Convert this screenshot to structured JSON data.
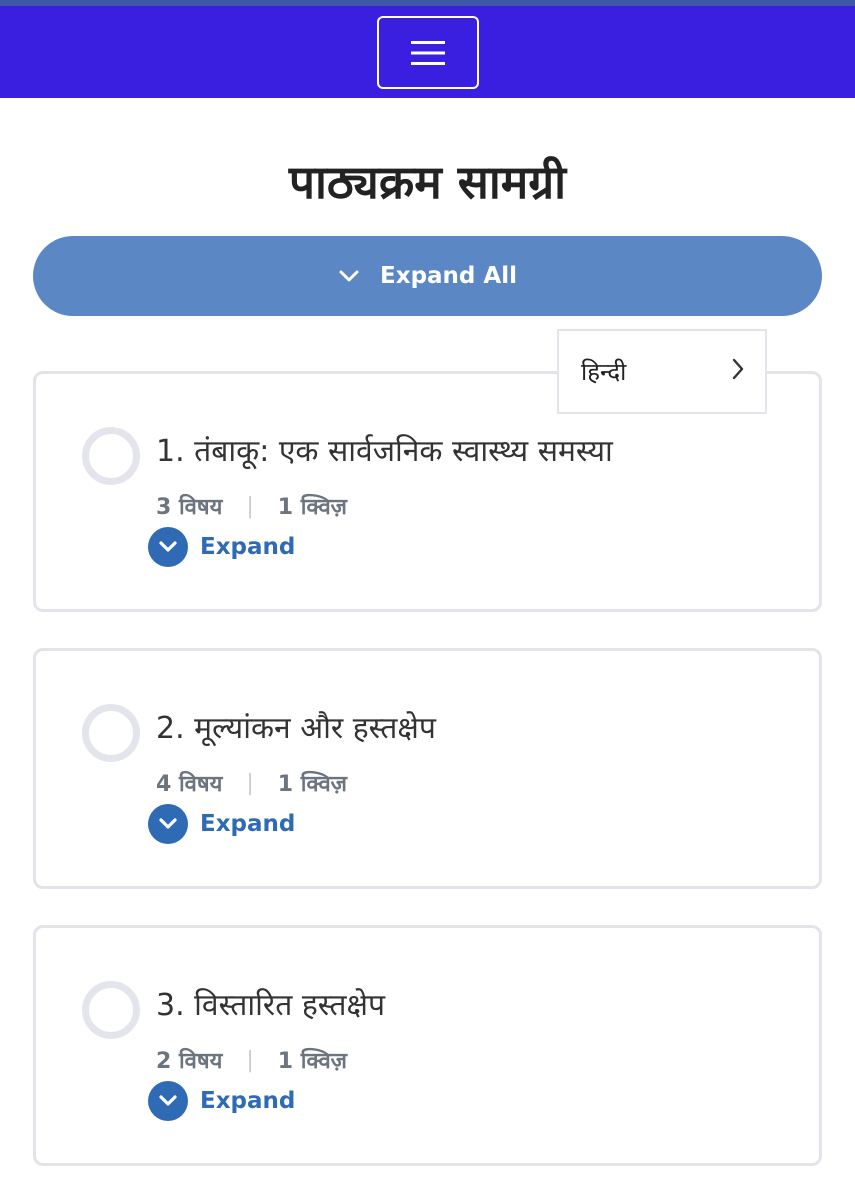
{
  "navbar": {
    "menu_icon": "hamburger-menu-icon"
  },
  "page": {
    "title": "पाठ्यक्रम सामग्री"
  },
  "expand_all": {
    "label": "Expand All",
    "icon": "chevron-down-icon"
  },
  "language": {
    "selected": "हिन्दी",
    "icon": "chevron-right-icon"
  },
  "modules": [
    {
      "title": "1. तंबाकू: एक सार्वजनिक स्वास्थ्य समस्या",
      "topics": "3 विषय",
      "separator": "|",
      "quizzes": "1 क्विज़",
      "expand_label": "Expand"
    },
    {
      "title": "2. मूल्यांकन और हस्तक्षेप",
      "topics": "4 विषय",
      "separator": "|",
      "quizzes": "1 क्विज़",
      "expand_label": "Expand"
    },
    {
      "title": "3. विस्तारित हस्तक्षेप",
      "topics": "2 विषय",
      "separator": "|",
      "quizzes": "1 क्विज़",
      "expand_label": "Expand"
    }
  ],
  "colors": {
    "navbar": "#3a1fe0",
    "expand_all_bg": "#5b88c4",
    "accent": "#2f6ab4",
    "card_border": "#e3e4ea"
  }
}
